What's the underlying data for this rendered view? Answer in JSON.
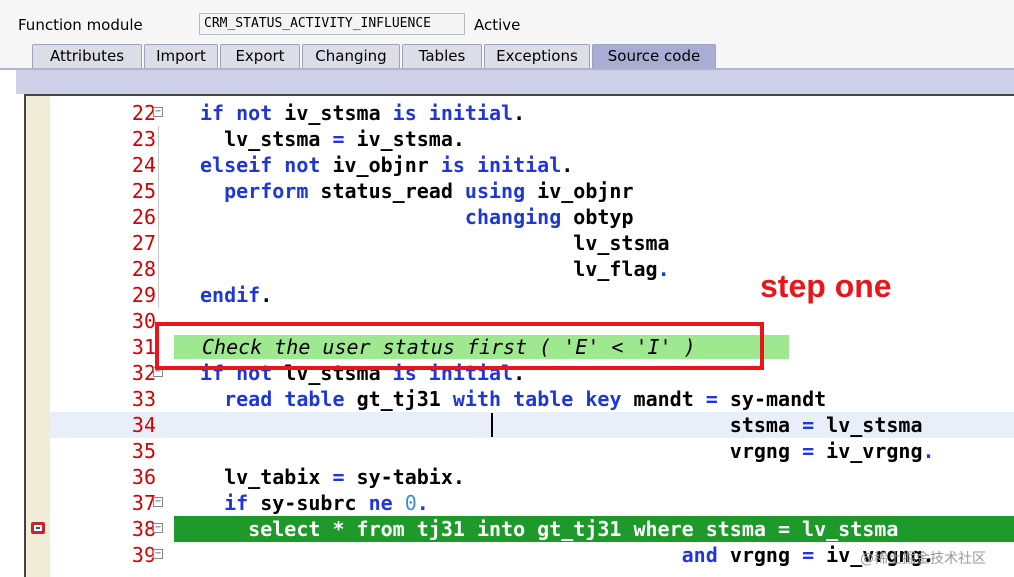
{
  "header": {
    "label": "Function module",
    "name": "CRM_STATUS_ACTIVITY_INFLUENCE",
    "status": "Active"
  },
  "tabs": [
    {
      "label": "Attributes"
    },
    {
      "label": "Import"
    },
    {
      "label": "Export"
    },
    {
      "label": "Changing"
    },
    {
      "label": "Tables"
    },
    {
      "label": "Exceptions"
    },
    {
      "label": "Source code",
      "active": true
    }
  ],
  "annotation": {
    "text": "step one",
    "color": "#e8151b"
  },
  "watermark": "@稀土掘金技术社区",
  "colors": {
    "keyword": "#1f37d9",
    "line_number": "#d40000",
    "exec_highlight": "#1d9a2a",
    "comment_highlight": "#9ee88f"
  },
  "code_lines": [
    {
      "num": "22",
      "segments": [
        [
          "kw",
          "if "
        ],
        [
          "kw",
          "not "
        ],
        [
          "",
          "iv_stsma "
        ],
        [
          "kw",
          "is "
        ],
        [
          "kw",
          "initial"
        ],
        [
          "",
          "."
        ]
      ]
    },
    {
      "num": "23",
      "segments": [
        [
          "",
          "  lv_stsma "
        ],
        [
          "kw",
          "= "
        ],
        [
          "",
          "iv_stsma."
        ]
      ]
    },
    {
      "num": "24",
      "segments": [
        [
          "kw",
          "elseif "
        ],
        [
          "kw",
          "not "
        ],
        [
          "",
          "iv_objnr "
        ],
        [
          "kw",
          "is "
        ],
        [
          "kw",
          "initial"
        ],
        [
          "",
          "."
        ]
      ]
    },
    {
      "num": "25",
      "segments": [
        [
          "",
          "  "
        ],
        [
          "kw",
          "perform "
        ],
        [
          "",
          "status_read "
        ],
        [
          "kw",
          "using "
        ],
        [
          "",
          "iv_objnr"
        ]
      ]
    },
    {
      "num": "26",
      "segments": [
        [
          "",
          "                      "
        ],
        [
          "kw",
          "changing "
        ],
        [
          "",
          "obtyp"
        ]
      ]
    },
    {
      "num": "27",
      "segments": [
        [
          "",
          "                               lv_stsma"
        ]
      ]
    },
    {
      "num": "28",
      "segments": [
        [
          "",
          "                               lv_flag"
        ],
        [
          "kw",
          "."
        ]
      ]
    },
    {
      "num": "29",
      "segments": [
        [
          "kw",
          "endif"
        ],
        [
          "",
          "."
        ]
      ]
    },
    {
      "num": "30",
      "segments": []
    },
    {
      "num": "31",
      "segments": [
        [
          "cmt",
          "Check the user status first ( 'E' < 'I' )"
        ]
      ]
    },
    {
      "num": "32",
      "segments": [
        [
          "kw",
          "if "
        ],
        [
          "kw",
          "not "
        ],
        [
          "",
          "lv_stsma "
        ],
        [
          "kw",
          "is "
        ],
        [
          "kw",
          "initial"
        ],
        [
          "",
          "."
        ]
      ]
    },
    {
      "num": "33",
      "segments": [
        [
          "",
          "  "
        ],
        [
          "kw",
          "read "
        ],
        [
          "kw",
          "table "
        ],
        [
          "",
          "gt_tj31 "
        ],
        [
          "kw",
          "with "
        ],
        [
          "kw",
          "table "
        ],
        [
          "kw",
          "key "
        ],
        [
          "",
          "mandt "
        ],
        [
          "kw",
          "= "
        ],
        [
          "",
          "sy-mandt"
        ]
      ]
    },
    {
      "num": "34",
      "segments": [
        [
          "",
          "                                            stsma "
        ],
        [
          "kw",
          "= "
        ],
        [
          "",
          "lv_stsma"
        ]
      ]
    },
    {
      "num": "35",
      "segments": [
        [
          "",
          "                                            vrgng "
        ],
        [
          "kw",
          "= "
        ],
        [
          "",
          "iv_vrgng"
        ],
        [
          "kw",
          "."
        ]
      ]
    },
    {
      "num": "36",
      "segments": [
        [
          "",
          "  lv_tabix "
        ],
        [
          "kw",
          "= "
        ],
        [
          "",
          "sy-tabix."
        ]
      ]
    },
    {
      "num": "37",
      "segments": [
        [
          "",
          "  "
        ],
        [
          "kw",
          "if "
        ],
        [
          "",
          "sy-subrc "
        ],
        [
          "kw",
          "ne "
        ],
        [
          "lit",
          "0"
        ],
        [
          "kw",
          "."
        ]
      ]
    },
    {
      "num": "38",
      "segments": [
        [
          "",
          "    select * from tj31 into gt_tj31 where stsma = lv_stsma"
        ]
      ]
    },
    {
      "num": "39",
      "segments": [
        [
          "",
          "                                        "
        ],
        [
          "kw",
          "and "
        ],
        [
          "",
          "vrgng "
        ],
        [
          "kw",
          "= "
        ],
        [
          "",
          "iv_vrgng."
        ]
      ]
    }
  ]
}
